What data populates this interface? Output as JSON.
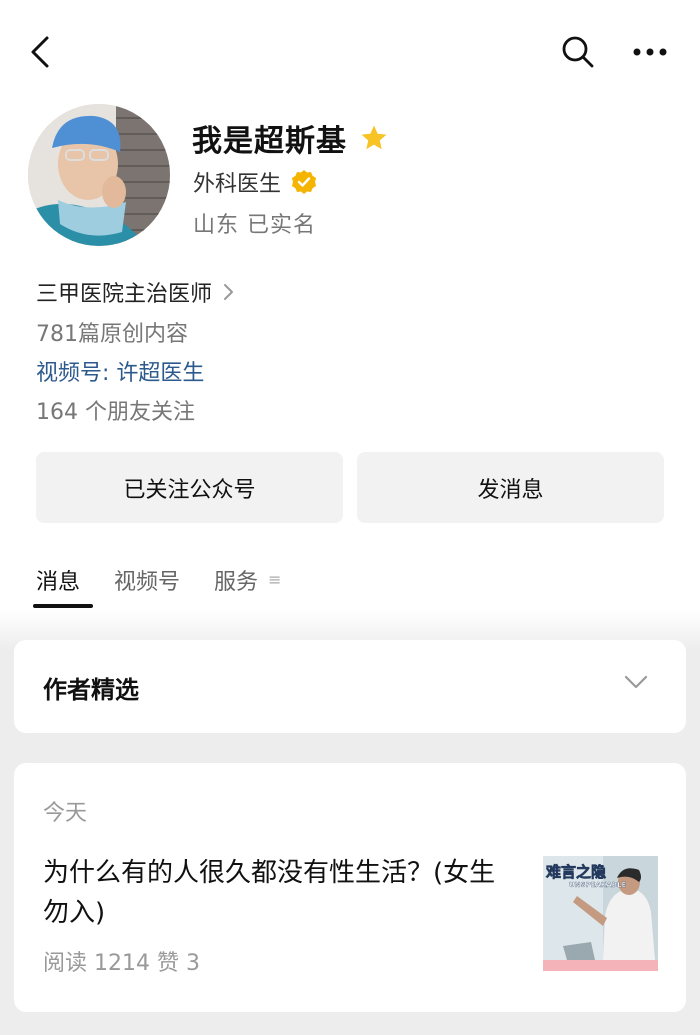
{
  "profile": {
    "name": "我是超斯基",
    "certification": "外科医生",
    "location": "山东 已实名",
    "description": "三甲医院主治医师",
    "article_count": "781篇原创内容",
    "video_channel": "视频号: 许超医生",
    "friends_following": "164 个朋友关注"
  },
  "actions": {
    "follow_label": "已关注公众号",
    "message_label": "发消息"
  },
  "tabs": [
    {
      "label": "消息",
      "active": true
    },
    {
      "label": "视频号",
      "active": false
    },
    {
      "label": "服务",
      "active": false
    }
  ],
  "picks": {
    "title": "作者精选"
  },
  "feed": {
    "date": "今天",
    "article": {
      "headline": "为什么有的人很久都没有性生活？(女生勿入)",
      "stats": "阅读 1214  赞 3",
      "thumb_title": "难言之隐",
      "thumb_subtitle": "UNSPEAKABLE"
    }
  },
  "colors": {
    "star": "#f7c325",
    "verified": "#f4b400",
    "link": "#2d5a8c"
  },
  "icons": {
    "back": "back-icon",
    "search": "search-icon",
    "more": "more-icon",
    "star": "star-icon",
    "verified": "verified-icon",
    "chevron": "chevron-right-icon",
    "expand": "chevron-down-icon",
    "tab_menu": "menu-icon"
  }
}
